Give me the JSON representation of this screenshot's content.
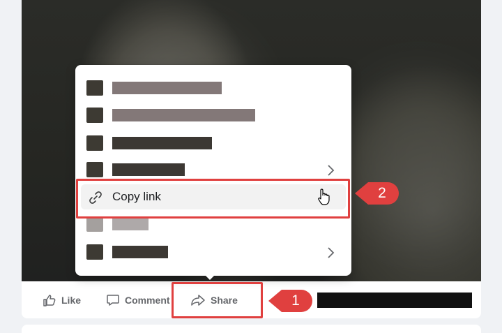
{
  "post": {
    "actions": {
      "like_label": "Like",
      "comment_label": "Comment",
      "share_label": "Share"
    }
  },
  "share_menu": {
    "copy_link_label": "Copy link",
    "items": [
      {
        "text": "",
        "redacted": true,
        "has_submenu": false
      },
      {
        "text": "",
        "redacted": true,
        "has_submenu": false
      },
      {
        "text": "",
        "redacted": true,
        "has_submenu": false
      },
      {
        "text": "",
        "redacted": true,
        "has_submenu": true
      },
      {
        "text": "Copy link",
        "redacted": false,
        "has_submenu": false,
        "hovered": true
      },
      {
        "text": "",
        "redacted": true,
        "has_submenu": false
      },
      {
        "text": "",
        "redacted": true,
        "has_submenu": true
      }
    ]
  },
  "annotations": {
    "step1_label": "1",
    "step2_label": "2",
    "highlight_color": "#e0403f"
  },
  "icons": {
    "like": "thumbs-up-icon",
    "comment": "comment-bubble-icon",
    "share": "share-arrow-icon",
    "copy_link": "link-icon",
    "submenu": "chevron-right-icon",
    "cursor": "hand-pointer-icon"
  }
}
